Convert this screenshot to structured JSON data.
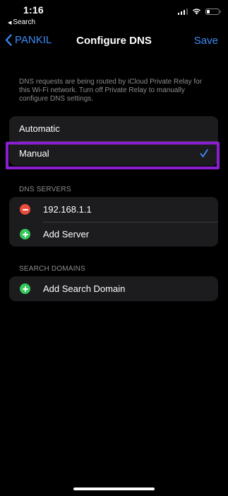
{
  "status_bar": {
    "time": "1:16",
    "back_label": "Search",
    "signal_icon": "cellular-signal-icon",
    "wifi_icon": "wifi-icon",
    "battery_icon": "battery-icon",
    "battery_level": 0.25
  },
  "nav": {
    "back_label": "PANKIL",
    "title": "Configure DNS",
    "save_label": "Save",
    "accent_color": "#3e8bf5"
  },
  "info_text": "DNS requests are being routed by iCloud Private Relay for this Wi-Fi network. Turn off Private Relay to manually configure DNS settings.",
  "mode_options": {
    "items": [
      {
        "label": "Automatic",
        "selected": false
      },
      {
        "label": "Manual",
        "selected": true
      }
    ],
    "highlight_color": "#8a1fd1"
  },
  "dns_servers": {
    "header": "DNS SERVERS",
    "servers": [
      {
        "address": "192.168.1.1",
        "icon": "remove-circle-icon"
      }
    ],
    "add_label": "Add Server",
    "add_icon": "add-circle-icon"
  },
  "search_domains": {
    "header": "SEARCH DOMAINS",
    "add_label": "Add Search Domain",
    "add_icon": "add-circle-icon"
  }
}
